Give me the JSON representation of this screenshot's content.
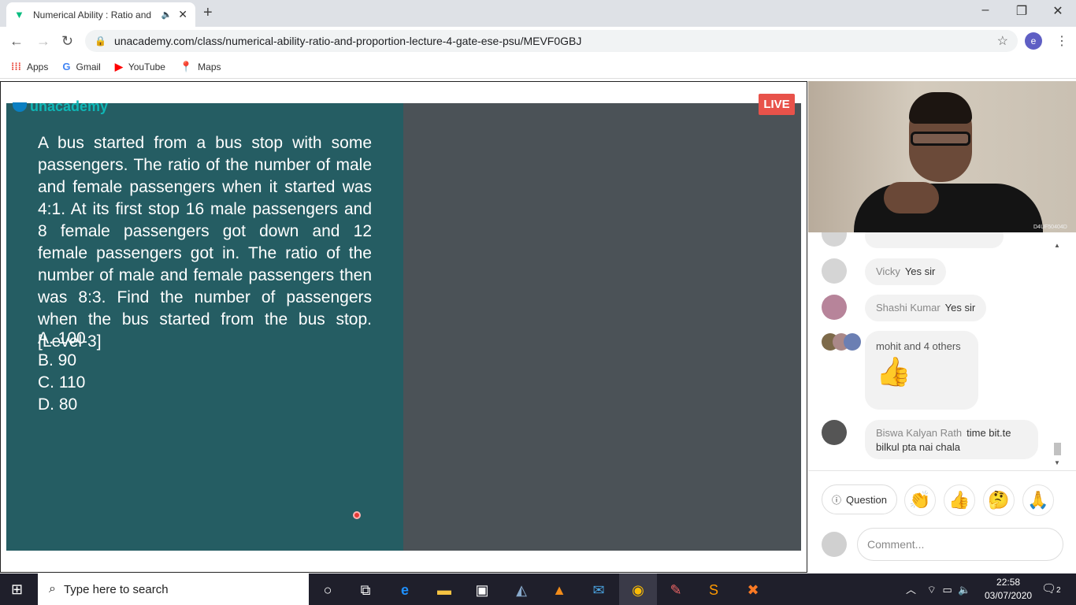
{
  "browser": {
    "tab_title": "Numerical Ability : Ratio and",
    "new_tab": "+",
    "url": "unacademy.com/class/numerical-ability-ratio-and-proportion-lecture-4-gate-ese-psu/MEVF0GBJ",
    "profile_initial": "e",
    "window_min": "–",
    "window_max": "❐",
    "window_close": "✕",
    "bookmarks": [
      {
        "label": "Apps",
        "icon": "apps-grid-icon"
      },
      {
        "label": "Gmail",
        "icon": "google-icon"
      },
      {
        "label": "YouTube",
        "icon": "youtube-icon"
      },
      {
        "label": "Maps",
        "icon": "maps-pin-icon"
      }
    ]
  },
  "player": {
    "logo": "unacademy",
    "live_label": "LIVE",
    "question": "A bus started from a bus stop with some passengers. The ratio of the number of male and female passengers when it started was 4:1. At its first stop 16 male passengers and 8 female passengers got down and 12 female passengers got in. The ratio of the number of male and female passengers then was 8:3. Find the number of passengers when the bus started from the bus stop. [Level-3]",
    "options": [
      "A. 100",
      "B. 90",
      "C. 110",
      "D. 80"
    ],
    "camera_id": "D4UF50404D"
  },
  "chat": {
    "messages": [
      {
        "name": "Vicky",
        "text": "Yes sir"
      },
      {
        "name": "Shashi Kumar",
        "text": "Yes sir"
      },
      {
        "name": "mohit and 4 others",
        "text": "👍"
      },
      {
        "name": "Biswa Kalyan Rath",
        "text": "time bit.te bilkul pta nai chala"
      }
    ],
    "question_button": "Question",
    "reactions": [
      "👏",
      "👍",
      "🤔",
      "🙏"
    ],
    "comment_placeholder": "Comment..."
  },
  "taskbar": {
    "search_placeholder": "Type here to search",
    "time": "22:58",
    "date": "03/07/2020",
    "notifications": "2"
  },
  "colors": {
    "slide_bg": "#255d63",
    "live_red": "#e8524a",
    "brand": "#08bd80"
  }
}
